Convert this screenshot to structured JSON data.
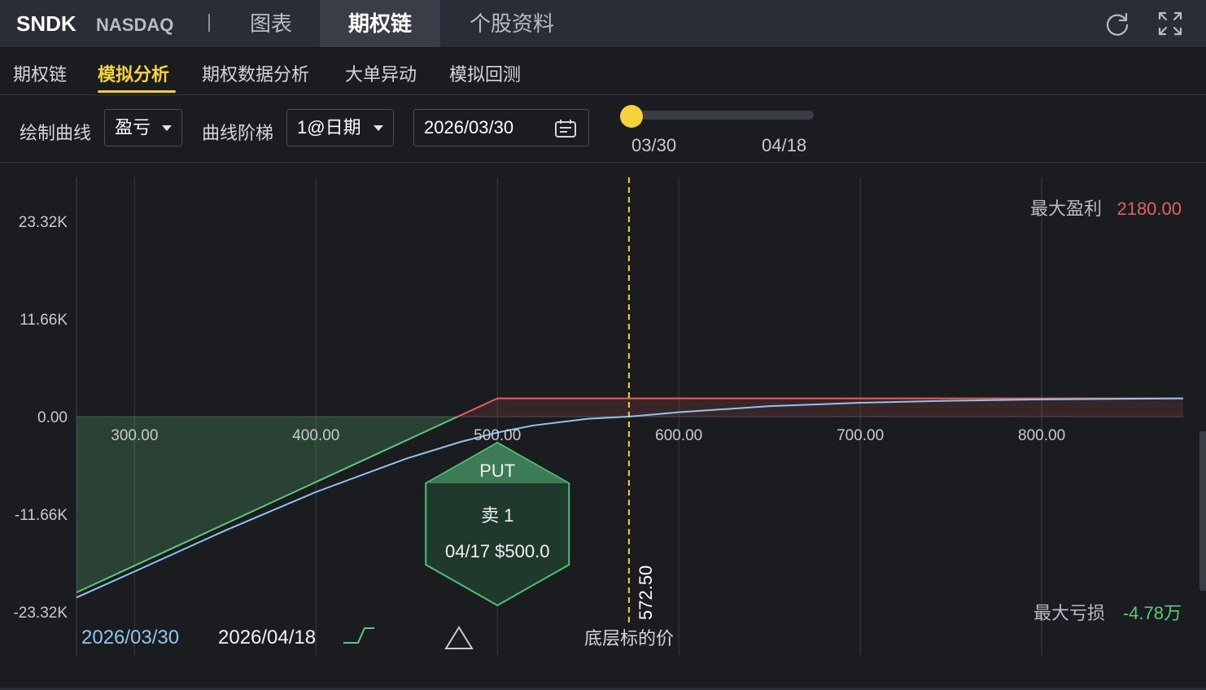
{
  "header": {
    "ticker": "SNDK",
    "exchange": "NASDAQ",
    "tabs": [
      "图表",
      "期权链",
      "个股资料"
    ],
    "active_tab": "期权链",
    "refresh_icon": "refresh-icon",
    "expand_icon": "expand-icon"
  },
  "subnav": {
    "tabs": [
      "期权链",
      "模拟分析",
      "期权数据分析",
      "大单异动",
      "模拟回测"
    ],
    "active_tab": "模拟分析"
  },
  "controls": {
    "curve_label": "绘制曲线",
    "curve_value": "盈亏",
    "step_label": "曲线阶梯",
    "step_value": "1@日期",
    "date_value": "2026/03/30",
    "calendar_icon": "calendar-icon",
    "slider_start": "03/30",
    "slider_end": "04/18",
    "slider_position": 0
  },
  "chart_data": {
    "type": "line",
    "xlim": [
      268,
      878
    ],
    "ylim": [
      -23320,
      23320
    ],
    "x_ticks": [
      "300.00",
      "400.00",
      "500.00",
      "600.00",
      "700.00",
      "800.00"
    ],
    "y_ticks": [
      "23.32K",
      "11.66K",
      "0.00",
      "-11.66K",
      "-23.32K"
    ],
    "series": [
      {
        "name": "2026/03/30",
        "color": "#8ec5f2",
        "x": [
          268,
          300,
          350,
          400,
          450,
          480,
          500,
          520,
          550,
          572.5,
          600,
          650,
          700,
          750,
          800,
          878
        ],
        "y": [
          -21600,
          -18500,
          -13600,
          -9000,
          -5000,
          -3000,
          -1900,
          -1050,
          -250,
          0,
          520,
          1250,
          1650,
          1900,
          2050,
          2180
        ]
      },
      {
        "name": "2026/04/18",
        "color": "#5cc87a",
        "x": [
          268,
          500,
          878
        ],
        "y": [
          -21000,
          2180,
          2180
        ]
      }
    ],
    "current_price_value": 572.5,
    "current_price": "572.50",
    "x_axis_title": "底层标的价",
    "max_profit_label": "最大盈利",
    "max_profit_value": "2180.00",
    "max_loss_label": "最大亏损",
    "max_loss_value": "-4.78万",
    "marker": {
      "type": "PUT",
      "action": "卖 1",
      "detail": "04/17 $500.0",
      "strike": 500
    },
    "profit_color": "#e15f5f",
    "loss_color": "#5cc87a",
    "price_line_color": "#f5d23c"
  }
}
